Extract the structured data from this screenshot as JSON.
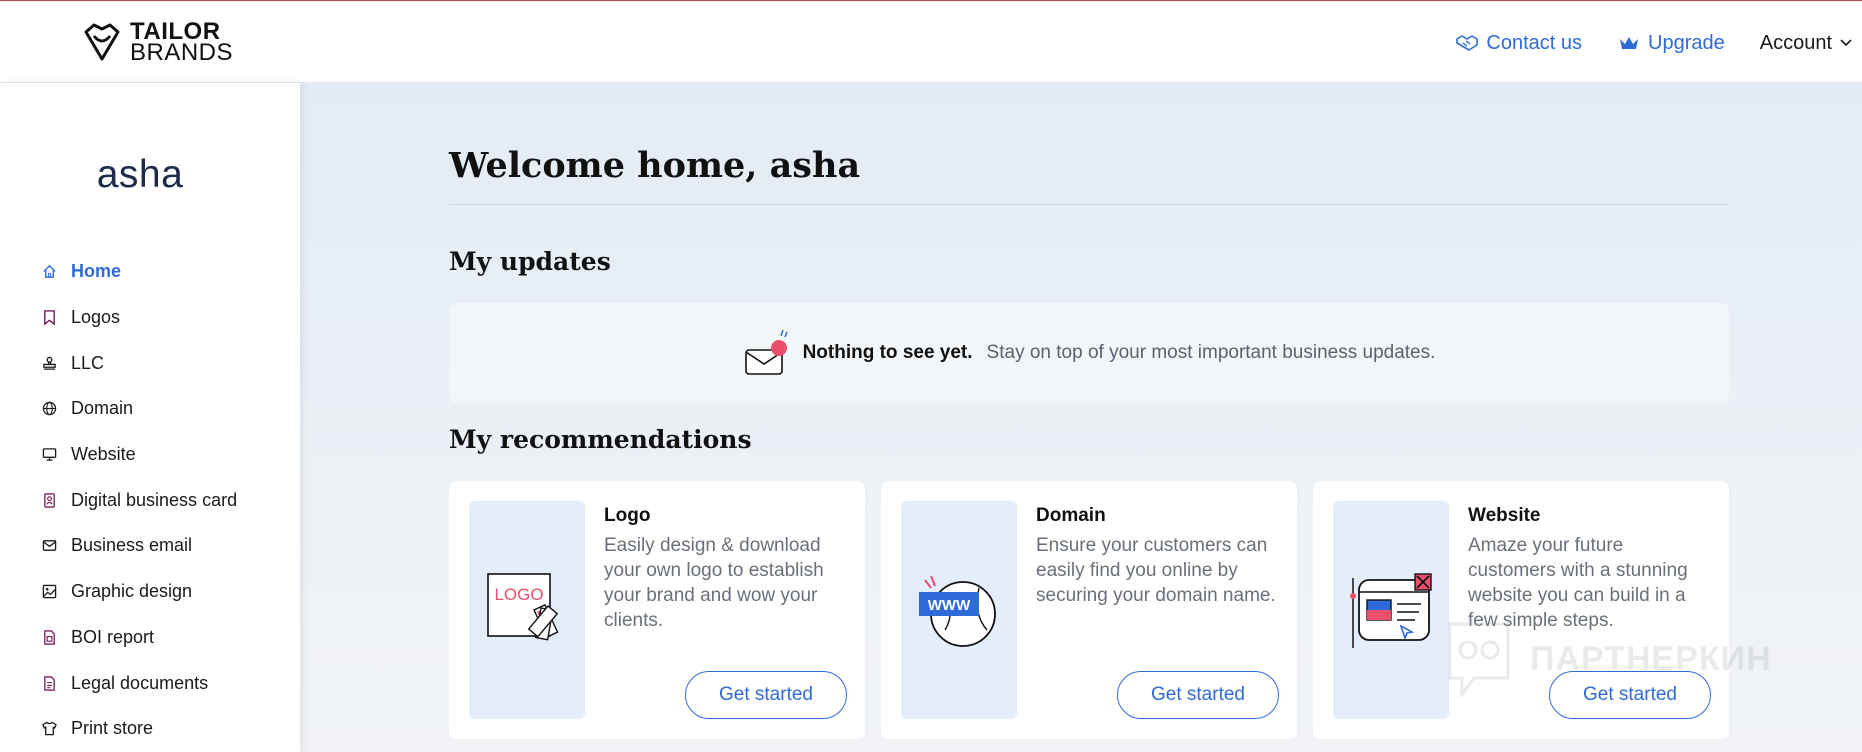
{
  "brand": {
    "line1": "TAILOR",
    "line2": "BRANDS",
    "icon": "tailor-brands-logo-icon"
  },
  "header": {
    "contact_label": "Contact us",
    "upgrade_label": "Upgrade",
    "account_label": "Account",
    "accent_color": "#2f6bd8"
  },
  "sidebar": {
    "username": "asha",
    "items": [
      {
        "label": "Home",
        "icon": "home-icon",
        "active": true
      },
      {
        "label": "Logos",
        "icon": "bookmark-icon"
      },
      {
        "label": "LLC",
        "icon": "stamp-icon"
      },
      {
        "label": "Domain",
        "icon": "globe-icon"
      },
      {
        "label": "Website",
        "icon": "monitor-icon"
      },
      {
        "label": "Digital business card",
        "icon": "id-card-icon"
      },
      {
        "label": "Business email",
        "icon": "mail-icon"
      },
      {
        "label": "Graphic design",
        "icon": "image-icon"
      },
      {
        "label": "BOI report",
        "icon": "report-icon"
      },
      {
        "label": "Legal documents",
        "icon": "document-icon"
      },
      {
        "label": "Print store",
        "icon": "tshirt-icon"
      }
    ]
  },
  "main": {
    "title": "Welcome home, asha",
    "updates": {
      "heading": "My updates",
      "empty_strong": "Nothing to see yet.",
      "empty_desc": "Stay on top of your most important business updates."
    },
    "recommendations": {
      "heading": "My recommendations",
      "cards": [
        {
          "title": "Logo",
          "description": "Easily design & download your own logo to establish your brand and wow your clients.",
          "button": "Get started",
          "thumb_text": "LOGO"
        },
        {
          "title": "Domain",
          "description": "Ensure your customers can easily find you online by securing your domain name.",
          "button": "Get started",
          "thumb_text": "WWW"
        },
        {
          "title": "Website",
          "description": "Amaze your future customers with a stunning website you can build in a few simple steps.",
          "button": "Get started"
        }
      ]
    }
  },
  "watermark": {
    "text": "ПАРТНЕРКИН"
  }
}
